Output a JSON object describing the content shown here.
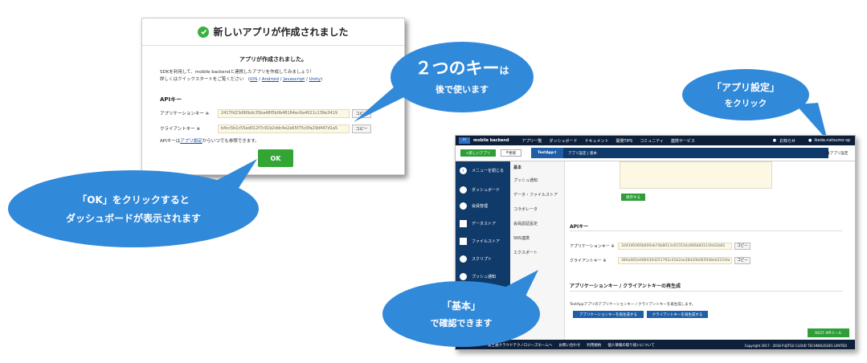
{
  "dialog": {
    "title": "新しいアプリが作成されました",
    "subtitle": "アプリが作成されました。",
    "desc_line1": "SDKを利用して、mobile backendと連携したアプリを作成してみましょう！",
    "desc_line2_prefix": "詳しくはクイックスタートをご覧ください　(",
    "links": [
      "iOS",
      "Android",
      "Javascript",
      "Unity"
    ],
    "desc_line2_suffix": ")",
    "api_key_heading": "APIキー",
    "app_key_label": "アプリケーションキー ※",
    "app_key_value": "2417fd23d90bdc35ba48f5b0b48164ec6a4021c139e3419",
    "client_key_label": "クライアントキー ※",
    "client_key_value": "b4cc5b1c55ad012f7c91b2ddc4e2a65f75c0fa29d447d1a5",
    "copy_label": "コピー",
    "note_prefix": "APIキーは",
    "note_link": "アプリ設定",
    "note_suffix": "からいつでも参照できます。",
    "ok_label": "OK"
  },
  "bubbles": {
    "keys_line1": "２つのキー",
    "keys_line1b": "は",
    "keys_line2": "後で使います",
    "settings_line1": "「アプリ設定」",
    "settings_line2": "をクリック",
    "ok_line1": "「OK」をクリックすると",
    "ok_line2": "ダッシュボードが表示されます",
    "basic_line1": "「基本」",
    "basic_line2": "で確認できます"
  },
  "app": {
    "logo": "mobile backend",
    "nav": [
      "アプリ一覧",
      "ダッシュボード",
      "ドキュメント",
      "開発TIPS",
      "コミュニティ",
      "連携サービス"
    ],
    "notice": "お知らせ",
    "user": "ikeda.natsumo-sp",
    "new_app": "+新しいアプリ",
    "refresh": "更新",
    "app_name": "TestApp",
    "breadcrumb": "アプリ設定 | 基本",
    "settings": "アプリ設定",
    "sidebar": [
      "メニューを閉じる",
      "ダッシュボード",
      "会員管理",
      "データストア",
      "ファイルストア",
      "スクリプト",
      "プッシュ通知"
    ],
    "submenu": [
      "基本",
      "プッシュ通知",
      "データ・ファイルストア",
      "コラボレータ",
      "会員認証設定",
      "SNS連携",
      "エクスポート"
    ],
    "save": "保存する",
    "api_heading": "APIキー",
    "app_key_label": "アプリケーションキー ※",
    "app_key_value": "3d4349360b600eb74b8013c615534c866b83113fe02b61",
    "client_key_label": "クライアントキー ※",
    "client_key_value": "384a065ef48f436d251792c41b2aa38d20b065948eb521fda",
    "copy": "コピー",
    "regen_heading": "アプリケーションキー / クライアントキーの再生成",
    "regen_desc": "TestAppアプリのアプリケーションキー / クライアントキーを再生成します。",
    "regen_app": "アプリケーションキーを再生成する",
    "regen_client": "クライアントキーを再生成する",
    "rest": "REST APIツール",
    "footer_links": [
      "富士通クラウドテクノロジーズホームへ",
      "お問い合わせ",
      "利用規約",
      "個人情報の取り扱いについて"
    ],
    "copyright": "Copyright 2017 - 2018 FUJITSU CLOUD TECHNOLOGIES LIMITED"
  }
}
